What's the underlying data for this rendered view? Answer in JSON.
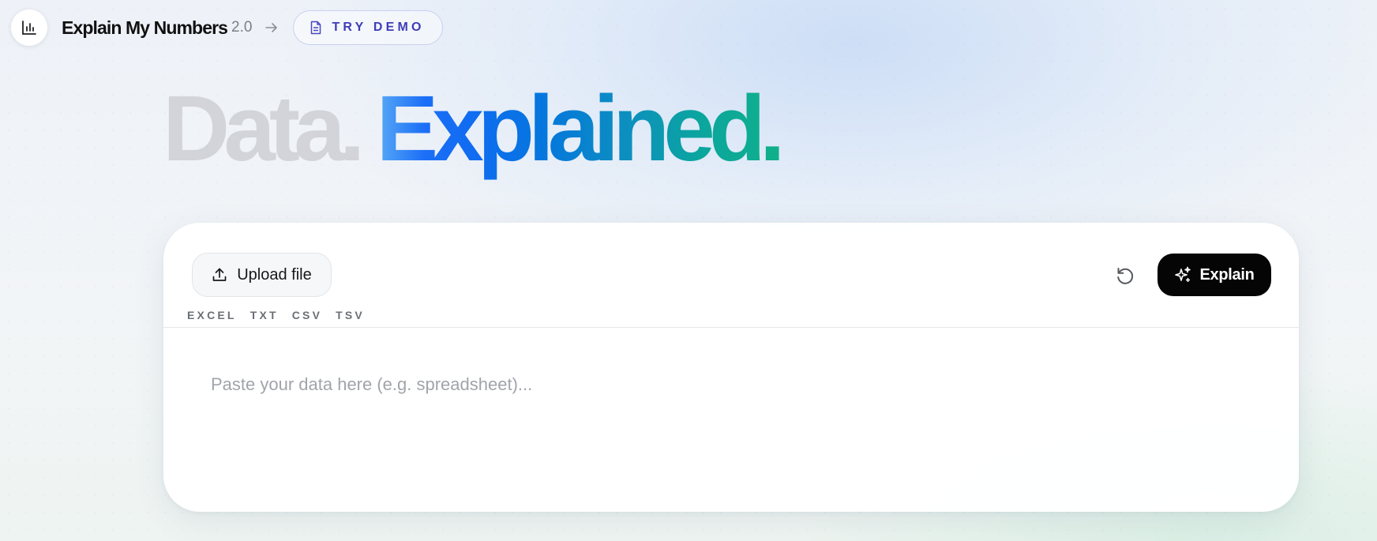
{
  "header": {
    "logo_icon": "bar-chart-icon",
    "app_name": "Explain My Numbers",
    "version": "2.0",
    "arrow_icon": "arrow-right-icon",
    "demo_button": {
      "icon": "document-icon",
      "label": "TRY DEMO"
    }
  },
  "hero": {
    "part1": "Data.",
    "part2": "Explained.",
    "gradient_colors": [
      "#5aaaf5",
      "#1b6ef7",
      "#0577dd",
      "#0c8fbf",
      "#10b08a"
    ],
    "muted_color": "#d3d4d9"
  },
  "card": {
    "upload_button": {
      "icon": "upload-icon",
      "label": "Upload file"
    },
    "formats": [
      "EXCEL",
      "TXT",
      "CSV",
      "TSV"
    ],
    "reset_button": {
      "icon": "reset-icon"
    },
    "explain_button": {
      "icon": "sparkles-icon",
      "label": "Explain"
    },
    "input": {
      "placeholder": "Paste your data here (e.g. spreadsheet)...",
      "value": ""
    }
  },
  "colors": {
    "accent": "#3f3cb8",
    "explain_button_bg": "#050505"
  }
}
